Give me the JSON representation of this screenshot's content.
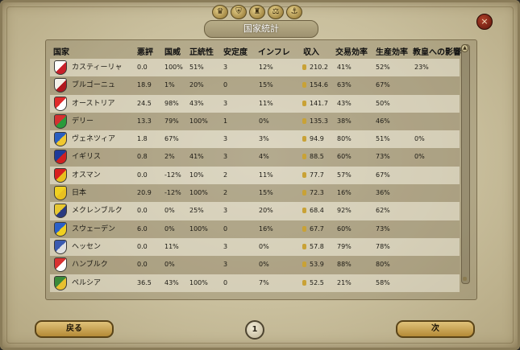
{
  "window": {
    "title": "国家統計",
    "close_label": "×"
  },
  "top_icons": [
    "top-icon-1",
    "top-icon-2",
    "top-icon-3",
    "top-icon-4",
    "top-icon-5"
  ],
  "columns": {
    "country": "国家",
    "infamy": "悪評",
    "prestige": "国威",
    "legitimacy": "正統性",
    "stability": "安定度",
    "inflation": "インフレ",
    "income": "収入",
    "trade": "交易効率",
    "production": "生産効率",
    "papal": "教皇への影響"
  },
  "rows": [
    {
      "name": "カスティーリャ",
      "infamy": "0.0",
      "prestige": "100%",
      "legitimacy": "51%",
      "stability": "3",
      "inflation": "12%",
      "income": "210.2",
      "trade": "41%",
      "production": "52%",
      "papal": "23%",
      "c1": "#ffffff",
      "c2": "#c8202a"
    },
    {
      "name": "ブルゴーニュ",
      "infamy": "18.9",
      "prestige": "1%",
      "legitimacy": "20%",
      "stability": "0",
      "inflation": "15%",
      "income": "154.6",
      "trade": "63%",
      "production": "67%",
      "papal": "",
      "c1": "#f3f0ea",
      "c2": "#b01820"
    },
    {
      "name": "オーストリア",
      "infamy": "24.5",
      "prestige": "98%",
      "legitimacy": "43%",
      "stability": "3",
      "inflation": "11%",
      "income": "141.7",
      "trade": "43%",
      "production": "50%",
      "papal": "",
      "c1": "#e02a2a",
      "c2": "#ffffff"
    },
    {
      "name": "デリー",
      "infamy": "13.3",
      "prestige": "79%",
      "legitimacy": "100%",
      "stability": "1",
      "inflation": "0%",
      "income": "135.3",
      "trade": "38%",
      "production": "46%",
      "papal": "",
      "c1": "#d43030",
      "c2": "#2a9a3a"
    },
    {
      "name": "ヴェネツィア",
      "infamy": "1.8",
      "prestige": "67%",
      "legitimacy": "",
      "stability": "3",
      "inflation": "3%",
      "income": "94.9",
      "trade": "80%",
      "production": "51%",
      "papal": "0%",
      "c1": "#2a5fc0",
      "c2": "#f0c830"
    },
    {
      "name": "イギリス",
      "infamy": "0.8",
      "prestige": "2%",
      "legitimacy": "41%",
      "stability": "3",
      "inflation": "4%",
      "income": "88.5",
      "trade": "60%",
      "production": "73%",
      "papal": "0%",
      "c1": "#1c3a9a",
      "c2": "#d02020"
    },
    {
      "name": "オスマン",
      "infamy": "0.0",
      "prestige": "-12%",
      "legitimacy": "10%",
      "stability": "2",
      "inflation": "11%",
      "income": "77.7",
      "trade": "57%",
      "production": "67%",
      "papal": "",
      "c1": "#d82020",
      "c2": "#e8c020"
    },
    {
      "name": "日本",
      "infamy": "20.9",
      "prestige": "-12%",
      "legitimacy": "100%",
      "stability": "2",
      "inflation": "15%",
      "income": "72.3",
      "trade": "16%",
      "production": "36%",
      "papal": "",
      "c1": "#f0d020",
      "c2": "#e8c020"
    },
    {
      "name": "メクレンブルク",
      "infamy": "0.0",
      "prestige": "0%",
      "legitimacy": "25%",
      "stability": "3",
      "inflation": "20%",
      "income": "68.4",
      "trade": "92%",
      "production": "62%",
      "papal": "",
      "c1": "#e8c830",
      "c2": "#2a3a80"
    },
    {
      "name": "スウェーデン",
      "infamy": "6.0",
      "prestige": "0%",
      "legitimacy": "100%",
      "stability": "0",
      "inflation": "16%",
      "income": "67.7",
      "trade": "60%",
      "production": "73%",
      "papal": "",
      "c1": "#2a60c8",
      "c2": "#f0d020"
    },
    {
      "name": "ヘッセン",
      "infamy": "0.0",
      "prestige": "11%",
      "legitimacy": "",
      "stability": "3",
      "inflation": "0%",
      "income": "57.8",
      "trade": "79%",
      "production": "78%",
      "papal": "",
      "c1": "#3a5ab0",
      "c2": "#e0e0e0"
    },
    {
      "name": "ハンブルク",
      "infamy": "0.0",
      "prestige": "0%",
      "legitimacy": "",
      "stability": "3",
      "inflation": "0%",
      "income": "53.9",
      "trade": "88%",
      "production": "80%",
      "papal": "",
      "c1": "#d83030",
      "c2": "#ffffff"
    },
    {
      "name": "ペルシア",
      "infamy": "36.5",
      "prestige": "43%",
      "legitimacy": "100%",
      "stability": "0",
      "inflation": "7%",
      "income": "52.5",
      "trade": "21%",
      "production": "58%",
      "papal": "",
      "c1": "#3a8a3a",
      "c2": "#e8c030"
    }
  ],
  "footer": {
    "back_label": "戻る",
    "page": "1",
    "next_label": "次"
  }
}
